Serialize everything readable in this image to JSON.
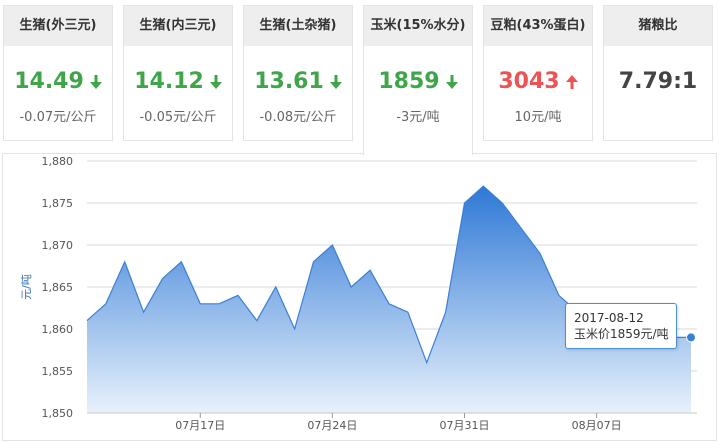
{
  "cards": [
    {
      "title": "生猪(外三元)",
      "price": "14.49",
      "direction": "down",
      "change": "-0.07",
      "unit": "元/公斤"
    },
    {
      "title": "生猪(内三元)",
      "price": "14.12",
      "direction": "down",
      "change": "-0.05",
      "unit": "元/公斤"
    },
    {
      "title": "生猪(土杂猪)",
      "price": "13.61",
      "direction": "down",
      "change": "-0.08",
      "unit": "元/公斤"
    },
    {
      "title": "玉米(15%水分)",
      "price": "1859",
      "direction": "down",
      "change": "-3",
      "unit": "元/吨"
    },
    {
      "title": "豆粕(43%蛋白)",
      "price": "3043",
      "direction": "up",
      "change": "10",
      "unit": "元/吨"
    },
    {
      "title": "猪粮比",
      "price": "7.79:1",
      "direction": "none",
      "change": "",
      "unit": ""
    }
  ],
  "active_card": 3,
  "colors": {
    "down": "#3fa549",
    "up": "#ee5253",
    "area_top": "#2e78d6",
    "area_bottom": "#e8f1fb",
    "line": "#3a80d2"
  },
  "chart_data": {
    "type": "area",
    "ylabel": "元/吨",
    "ylim": [
      1850,
      1880
    ],
    "yticks": [
      1850,
      1855,
      1860,
      1865,
      1870,
      1875,
      1880
    ],
    "xtick_labels": [
      "07月17日",
      "07月24日",
      "07月31日",
      "08月07日"
    ],
    "xtick_index": [
      6,
      13,
      20,
      27
    ],
    "x": [
      "2017-07-11",
      "2017-07-12",
      "2017-07-13",
      "2017-07-14",
      "2017-07-15",
      "2017-07-16",
      "2017-07-17",
      "2017-07-18",
      "2017-07-19",
      "2017-07-20",
      "2017-07-21",
      "2017-07-22",
      "2017-07-23",
      "2017-07-24",
      "2017-07-25",
      "2017-07-26",
      "2017-07-27",
      "2017-07-28",
      "2017-07-29",
      "2017-07-30",
      "2017-07-31",
      "2017-08-01",
      "2017-08-02",
      "2017-08-03",
      "2017-08-04",
      "2017-08-05",
      "2017-08-06",
      "2017-08-07",
      "2017-08-08",
      "2017-08-09",
      "2017-08-10",
      "2017-08-11",
      "2017-08-12"
    ],
    "values": [
      1861,
      1863,
      1868,
      1862,
      1866,
      1868,
      1863,
      1863,
      1864,
      1861,
      1865,
      1860,
      1868,
      1870,
      1865,
      1867,
      1863,
      1862,
      1856,
      1862,
      1875,
      1877,
      1875,
      1872,
      1869,
      1864,
      1862,
      1861,
      1860,
      1859,
      1859,
      1859,
      1859
    ],
    "grid": true,
    "tooltip": {
      "date": "2017-08-12",
      "label": "玉米价1859元/吨"
    }
  }
}
